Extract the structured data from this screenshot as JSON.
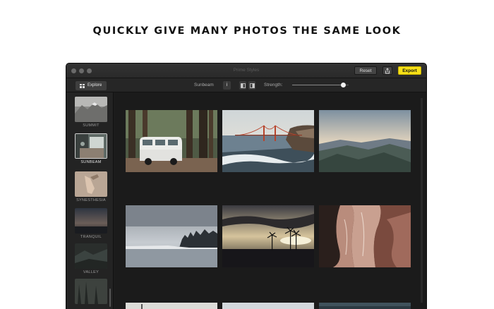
{
  "headline": "QUICKLY GIVE MANY PHOTOS THE SAME LOOK",
  "window": {
    "title": "Prime Styles",
    "reset_label": "Reset",
    "share_icon": "share-icon",
    "export_label": "Export",
    "accent_color": "#f7e018"
  },
  "toolbar": {
    "explore_label": "Explore",
    "current_style": "Sunbeam",
    "info_label": "i",
    "strength_label": "Strength:",
    "strength_value": 0.9
  },
  "sidebar": {
    "styles": [
      {
        "label": "SUMMIT",
        "selected": false
      },
      {
        "label": "SUNBEAM",
        "selected": true
      },
      {
        "label": "SYNESTHESIA",
        "selected": false
      },
      {
        "label": "TRANQUIL",
        "selected": false
      },
      {
        "label": "VALLEY",
        "selected": false
      },
      {
        "label": "",
        "selected": false
      }
    ]
  },
  "photos": [
    {
      "subject": "camper-van-forest"
    },
    {
      "subject": "golden-gate-bridge-beach"
    },
    {
      "subject": "mountain-ridge-sunset"
    },
    {
      "subject": "lake-shore-winter"
    },
    {
      "subject": "palm-trees-sunset"
    },
    {
      "subject": "red-rock-canyon"
    }
  ]
}
